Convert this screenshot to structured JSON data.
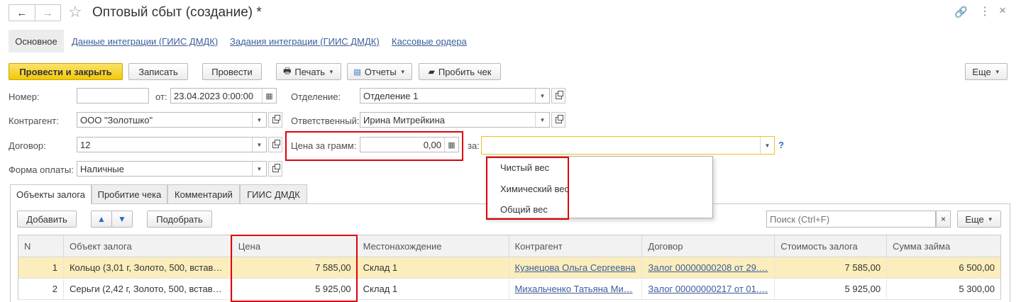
{
  "title": "Оптовый сбыт (создание) *",
  "nav": {
    "back": "←",
    "forward": "→"
  },
  "section_tabs": [
    "Основное",
    "Данные интеграции (ГИИС ДМДК)",
    "Задания интеграции (ГИИС ДМДК)",
    "Кассовые ордера"
  ],
  "toolbar": {
    "post_close": "Провести и закрыть",
    "save": "Записать",
    "post": "Провести",
    "print": "Печать",
    "reports": "Отчеты",
    "receipt": "Пробить чек",
    "more": "Еще"
  },
  "form": {
    "number_label": "Номер:",
    "number_value": "",
    "date_label": "от:",
    "date_value": "23.04.2023  0:00:00",
    "department_label": "Отделение:",
    "department_value": "Отделение 1",
    "contractor_label": "Контрагент:",
    "contractor_value": "ООО \"Золотшко\"",
    "responsible_label": "Ответственный:",
    "responsible_value": "Ирина Митрейкина",
    "contract_label": "Договор:",
    "contract_value": "12",
    "price_per_gram_label": "Цена за грамм:",
    "price_per_gram_value": "0,00",
    "per_label": "за:",
    "per_value": "",
    "help": "?",
    "payment_label": "Форма оплаты:",
    "payment_value": "Наличные"
  },
  "dropdown_options": [
    "Чистый вес",
    "Химический вес",
    "Общий вес"
  ],
  "doc_tabs": [
    "Объекты залога",
    "Пробитие чека",
    "Комментарий",
    "ГИИС ДМДК"
  ],
  "table_toolbar": {
    "add": "Добавить",
    "pick": "Подобрать",
    "search_placeholder": "Поиск (Ctrl+F)",
    "clear": "×",
    "more": "Еще"
  },
  "table": {
    "columns": [
      "N",
      "Объект залога",
      "Цена",
      "Местонахождение",
      "Контрагент",
      "Договор",
      "Стоимость залога",
      "Сумма займа"
    ],
    "rows": [
      [
        "1",
        "Кольцо (3,01 г, Золото, 500, встав…",
        "7 585,00",
        "Склад 1",
        "Кузнецова Ольга Сергеевна",
        "Залог 00000000208 от 29.…",
        "7 585,00",
        "6 500,00"
      ],
      [
        "2",
        "Серьги (2,42 г, Золото, 500, встав…",
        "5 925,00",
        "Склад 1",
        "Михальченко Татьяна Ми…",
        "Залог 00000000217 от 01.…",
        "5 925,00",
        "5 300,00"
      ]
    ]
  },
  "colors": {
    "primary_button": "#f2c80a",
    "highlight_box": "#e0000b",
    "selected_row": "#fbeebc",
    "link": "#3b5d9a"
  }
}
